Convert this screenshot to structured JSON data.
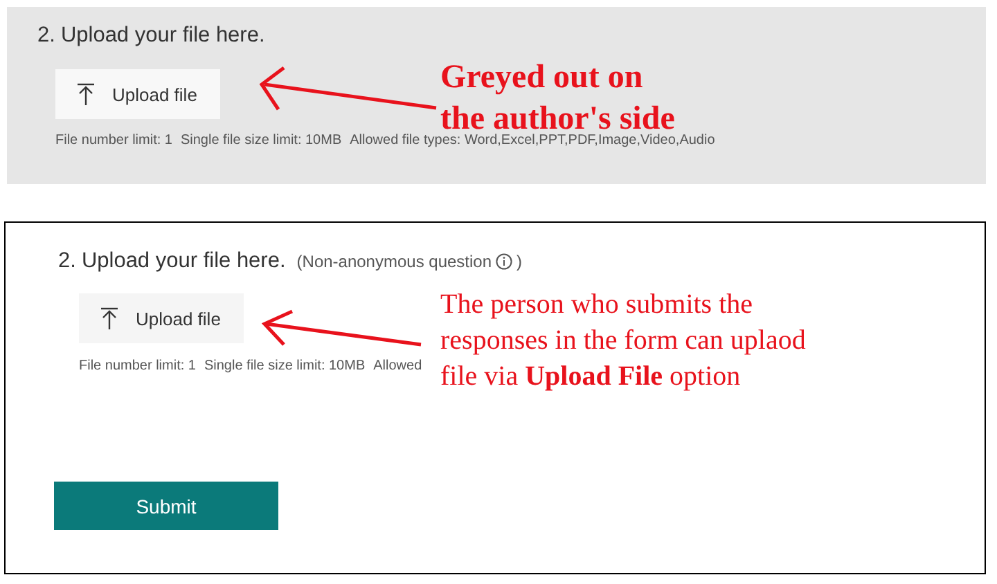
{
  "panels": [
    {
      "kind": "author",
      "number": "2.",
      "question": "Upload your file here.",
      "upload_label": "Upload file",
      "limits": [
        "File number limit: 1",
        "Single file size limit: 10MB",
        "Allowed file types: Word,Excel,PPT,PDF,Image,Video,Audio"
      ],
      "note": [
        "Greyed out on",
        "the author's side"
      ]
    },
    {
      "kind": "respondent",
      "number": "2.",
      "question": "Upload your file here.",
      "tag": "(Non-anonymous question",
      "tag_end": ")",
      "upload_label": "Upload file",
      "limits": [
        "File number limit: 1",
        "Single file size limit: 10MB",
        "Allowed"
      ],
      "note": [
        "The person who submits the",
        "responses in the form can uplaod",
        "file via **Upload File** option"
      ],
      "submit": "Submit"
    }
  ]
}
